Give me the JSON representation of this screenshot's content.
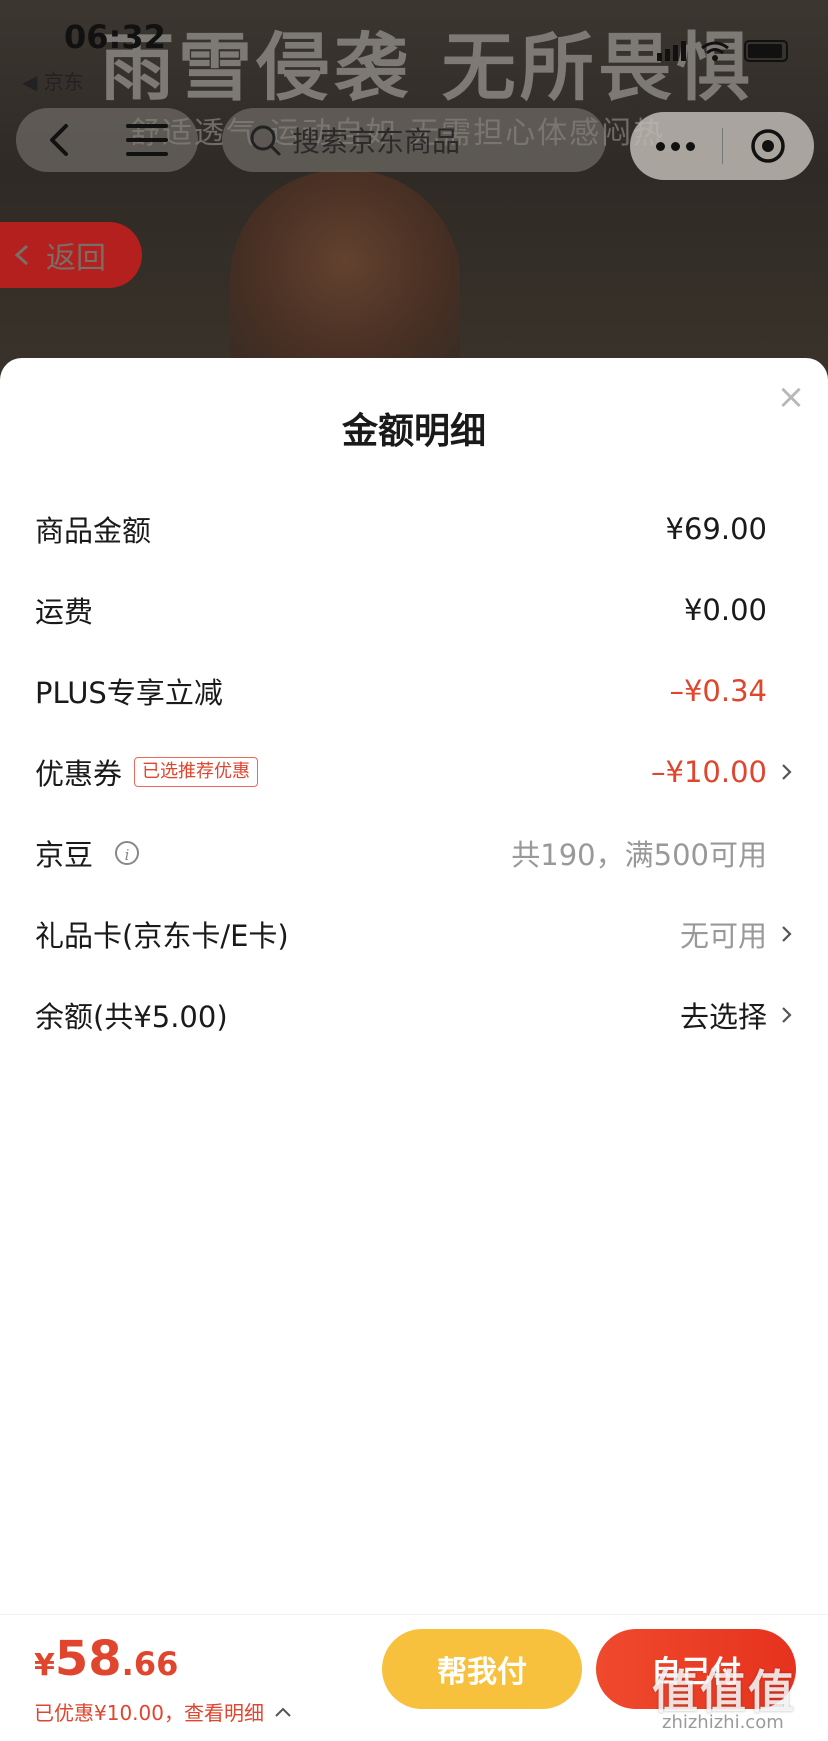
{
  "status_bar": {
    "time": "06:32",
    "back_app": "◀ 京东"
  },
  "background": {
    "headline": "雨雪侵袭 无所畏惧",
    "subline": "舒适透气 运动自如 无需担心体感闷热"
  },
  "nav": {
    "search_placeholder": "搜索京东商品",
    "return_label": "返回"
  },
  "sheet": {
    "title": "金额明细",
    "close": "×",
    "rows": [
      {
        "label": "商品金额",
        "value": "¥69.00"
      },
      {
        "label": "运费",
        "value": "¥0.00"
      },
      {
        "label": "PLUS专享立减",
        "value": "–¥0.34"
      },
      {
        "label": "优惠券",
        "tag": "已选推荐优惠",
        "value": "–¥10.00"
      },
      {
        "label": "京豆",
        "info": "i",
        "value": "共190，满500可用"
      },
      {
        "label": "礼品卡(京东卡/E卡)",
        "value": "无可用"
      },
      {
        "label": "余额(共¥5.00)",
        "value": "去选择"
      }
    ]
  },
  "bottom": {
    "currency": "¥",
    "total_int": "58",
    "total_dec": ".66",
    "saved_text": "已优惠¥10.00，",
    "detail_link": "查看明细",
    "help_pay": "帮我付",
    "self_pay": "自己付"
  },
  "watermark": {
    "text": "值值值",
    "url": "zhizhizhi.com"
  },
  "colors": {
    "accent_red": "#e0452e",
    "help_yellow": "#f7c13d",
    "pay_red": "#e6321e"
  }
}
